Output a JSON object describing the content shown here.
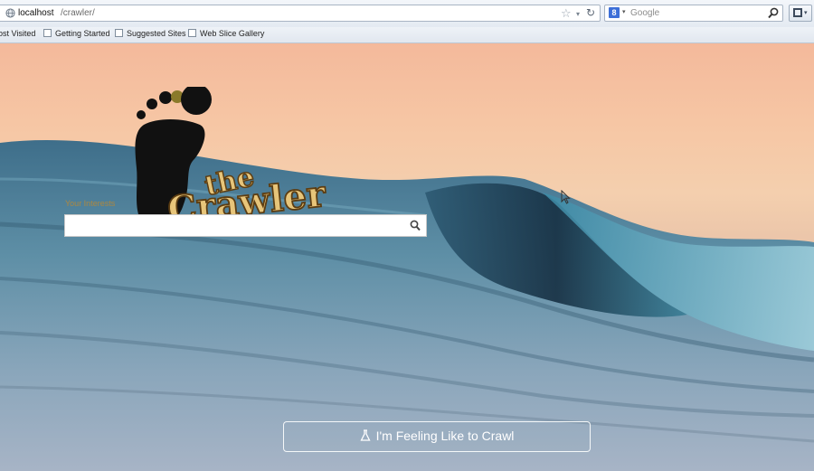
{
  "browser": {
    "address": {
      "host": "localhost",
      "path": "/crawler/"
    },
    "search": {
      "placeholder": "Google",
      "engine_icon": "8"
    },
    "icons": {
      "star": "☆",
      "dropdown": "▾",
      "reload": "↻"
    }
  },
  "bookmarks": [
    {
      "label": "ost Visited"
    },
    {
      "label": "Getting Started"
    },
    {
      "label": "Suggested Sites"
    },
    {
      "label": "Web Slice Gallery"
    }
  ],
  "page": {
    "logo": {
      "word1": "the",
      "word2": "Crawler"
    },
    "search_label": "Your Interests",
    "search_value": "",
    "feeling_button": "I'm Feeling Like to Crawl"
  },
  "colors": {
    "sky_top": "#f4b99b",
    "wave_dark": "#1f3f55",
    "logo_fill": "#e7c57a",
    "logo_outline": "#5c3d12"
  }
}
